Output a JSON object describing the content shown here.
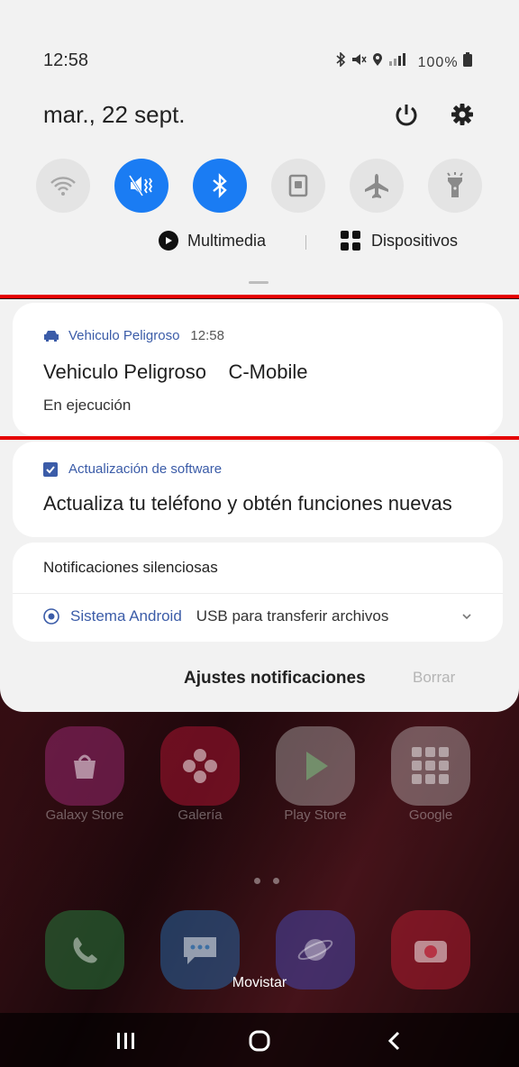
{
  "status_bar": {
    "time": "12:58",
    "battery_text": "100%",
    "icons": [
      "bluetooth-icon",
      "mute-icon",
      "location-icon",
      "signal-icon",
      "battery-icon"
    ]
  },
  "quick_panel": {
    "date": "mar., 22 sept.",
    "tiles": [
      {
        "name": "wifi",
        "icon": "wifi-icon",
        "on": false
      },
      {
        "name": "sound",
        "icon": "vibrate-mute-icon",
        "on": true
      },
      {
        "name": "bluetooth",
        "icon": "bluetooth-icon",
        "on": true
      },
      {
        "name": "rotation-lock",
        "icon": "portrait-lock-icon",
        "on": false
      },
      {
        "name": "airplane",
        "icon": "airplane-icon",
        "on": false
      },
      {
        "name": "flashlight",
        "icon": "flashlight-icon",
        "on": false
      }
    ],
    "media_label": "Multimedia",
    "devices_label": "Dispositivos",
    "accent_color": "#1a7cf3"
  },
  "notifications": {
    "vehicle": {
      "app_name": "Vehiculo Peligroso",
      "time": "12:58",
      "title": "Vehiculo Peligroso    C-Mobile",
      "subtitle": "En ejecución"
    },
    "software_update": {
      "app_name": "Actualización de software",
      "title": "Actualiza tu teléfono y obtén funciones nuevas"
    },
    "silent": {
      "section_label": "Notificaciones silenciosas",
      "app_name": "Sistema Android",
      "message": "USB para transferir archivos"
    },
    "footer": {
      "settings_label": "Ajustes notificaciones",
      "clear_label": "Borrar"
    }
  },
  "home_screen": {
    "apps": [
      {
        "label": "Galaxy Store"
      },
      {
        "label": "Galería"
      },
      {
        "label": "Play Store"
      },
      {
        "label": "Google"
      }
    ],
    "carrier": "Movistar"
  },
  "nav_bar": {
    "buttons": [
      "recents-icon",
      "home-icon",
      "back-icon"
    ]
  }
}
